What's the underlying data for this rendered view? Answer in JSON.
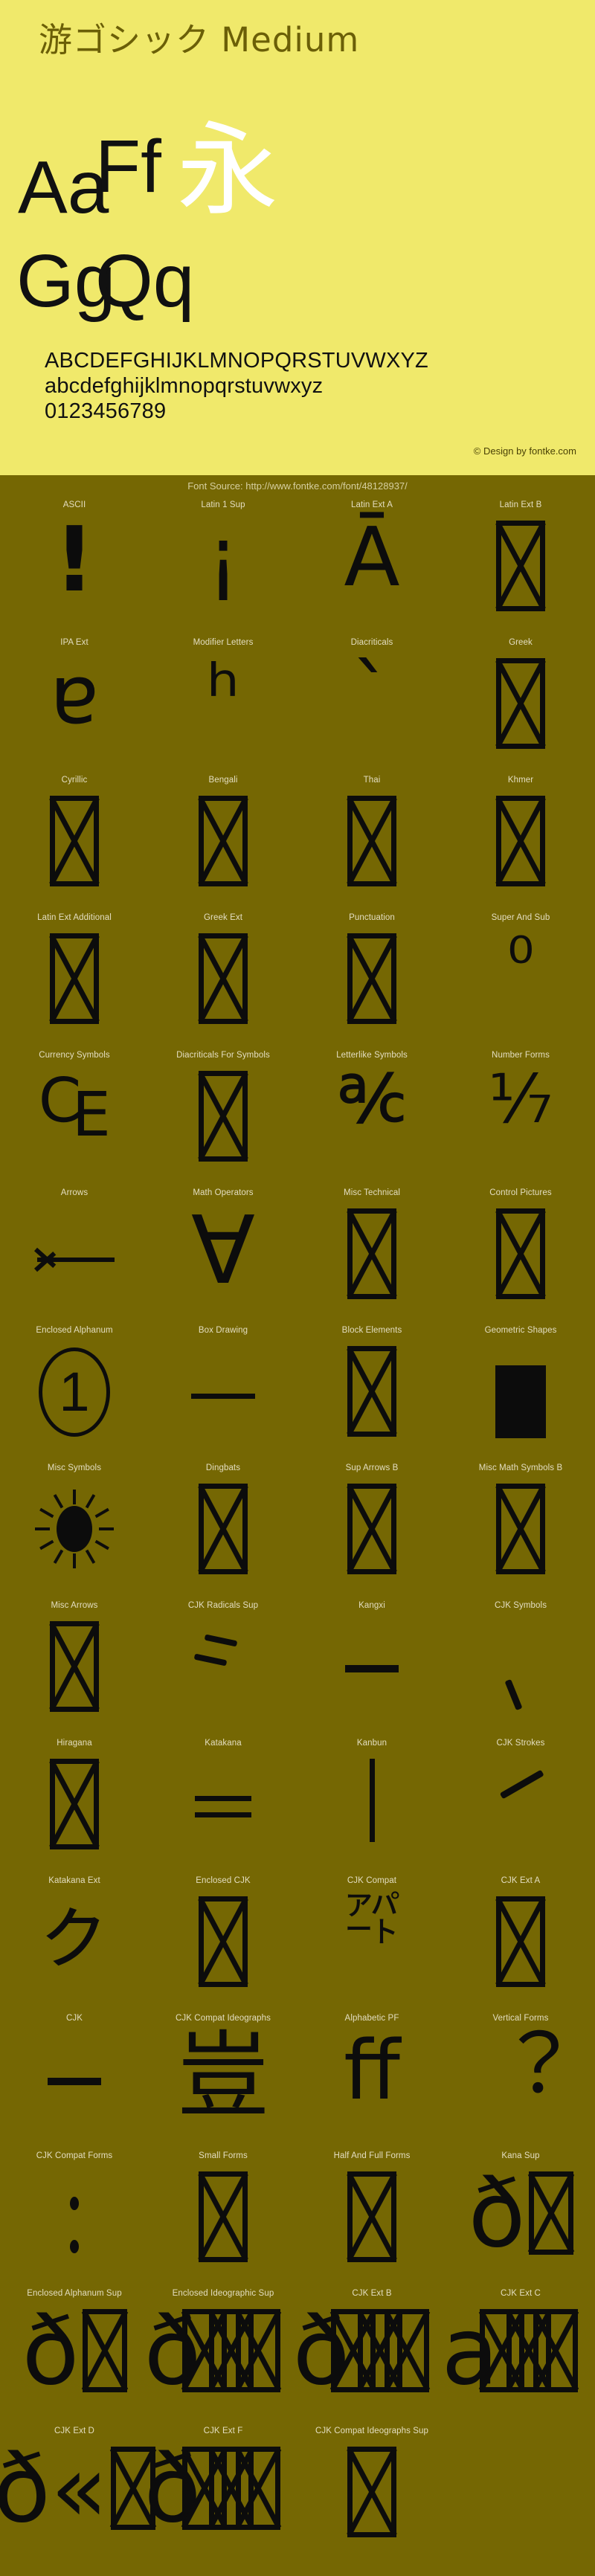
{
  "header": {
    "font_title": "游ゴシック Medium",
    "samples": [
      {
        "name": "sample-aa",
        "text": "Aa"
      },
      {
        "name": "sample-ff",
        "text": "Ff"
      },
      {
        "name": "sample-gg",
        "text": "Gg"
      },
      {
        "name": "sample-qq",
        "text": "Qq"
      },
      {
        "name": "sample-cjk",
        "text": "永"
      }
    ],
    "alphabet_upper": "ABCDEFGHIJKLMNOPQRSTUVWXYZ",
    "alphabet_lower": "abcdefghijklmnopqrstuvwxyz",
    "digits": "0123456789",
    "credit": "© Design by fontke.com"
  },
  "source_bar": {
    "text": "Font Source: http://www.fontke.com/font/48128937/"
  },
  "colors": {
    "header_bg": "#f0e96b",
    "body_bg": "#756703",
    "title_text": "#6b5f07",
    "glyph_black": "#0c0c0c",
    "glyph_white": "#ffffff",
    "label_text": "#e3ddc0",
    "source_text": "#d6cfa0"
  },
  "blocks": [
    {
      "label": "ASCII",
      "glyph": "!",
      "kind": "text-bang"
    },
    {
      "label": "Latin 1 Sup",
      "glyph": "¡",
      "kind": "text-plain"
    },
    {
      "label": "Latin Ext A",
      "glyph": "Ā",
      "kind": "text-plain"
    },
    {
      "label": "Latin Ext B",
      "glyph": "",
      "kind": "tofu"
    },
    {
      "label": "IPA Ext",
      "glyph": "ɐ",
      "kind": "text-plain"
    },
    {
      "label": "Modifier Letters",
      "glyph": "ʰ",
      "kind": "text-plain"
    },
    {
      "label": "Diacriticals",
      "glyph": "`",
      "kind": "text-plain"
    },
    {
      "label": "Greek",
      "glyph": "",
      "kind": "tofu"
    },
    {
      "label": "Cyrillic",
      "glyph": "",
      "kind": "tofu"
    },
    {
      "label": "Bengali",
      "glyph": "",
      "kind": "tofu"
    },
    {
      "label": "Thai",
      "glyph": "",
      "kind": "tofu"
    },
    {
      "label": "Khmer",
      "glyph": "",
      "kind": "tofu"
    },
    {
      "label": "Latin Ext Additional",
      "glyph": "",
      "kind": "tofu"
    },
    {
      "label": "Greek Ext",
      "glyph": "",
      "kind": "tofu"
    },
    {
      "label": "Punctuation",
      "glyph": "",
      "kind": "tofu"
    },
    {
      "label": "Super And Sub",
      "glyph": "⁰",
      "kind": "text-sup"
    },
    {
      "label": "Currency Symbols",
      "glyph": "₠",
      "kind": "text-plain"
    },
    {
      "label": "Diacriticals For Symbols",
      "glyph": "",
      "kind": "tofu"
    },
    {
      "label": "Letterlike Symbols",
      "glyph": "℀",
      "kind": "text-wide"
    },
    {
      "label": "Number Forms",
      "glyph": "⅐",
      "kind": "text-wide"
    },
    {
      "label": "Arrows",
      "glyph": "←",
      "kind": "arrow-left"
    },
    {
      "label": "Math Operators",
      "glyph": "∀",
      "kind": "text-big"
    },
    {
      "label": "Misc Technical",
      "glyph": "",
      "kind": "tofu"
    },
    {
      "label": "Control Pictures",
      "glyph": "",
      "kind": "tofu"
    },
    {
      "label": "Enclosed Alphanum",
      "glyph": "①",
      "kind": "circled-one"
    },
    {
      "label": "Box Drawing",
      "glyph": "─",
      "kind": "hline"
    },
    {
      "label": "Block Elements",
      "glyph": "",
      "kind": "tofu"
    },
    {
      "label": "Geometric Shapes",
      "glyph": "■",
      "kind": "black-rect"
    },
    {
      "label": "Misc Symbols",
      "glyph": "☀",
      "kind": "sun"
    },
    {
      "label": "Dingbats",
      "glyph": "",
      "kind": "tofu"
    },
    {
      "label": "Sup Arrows B",
      "glyph": "",
      "kind": "tofu"
    },
    {
      "label": "Misc Math Symbols B",
      "glyph": "",
      "kind": "tofu"
    },
    {
      "label": "Misc Arrows",
      "glyph": "",
      "kind": "tofu"
    },
    {
      "label": "CJK Radicals Sup",
      "glyph": "⺀",
      "kind": "radical-strokes"
    },
    {
      "label": "Kangxi",
      "glyph": "⼀",
      "kind": "hline-thick"
    },
    {
      "label": "CJK Symbols",
      "glyph": "、",
      "kind": "stroke-comma"
    },
    {
      "label": "Hiragana",
      "glyph": "",
      "kind": "tofu"
    },
    {
      "label": "Katakana",
      "glyph": "゠",
      "kind": "eq2"
    },
    {
      "label": "Kanbun",
      "glyph": "丨",
      "kind": "vline"
    },
    {
      "label": "CJK Strokes",
      "glyph": "㇀",
      "kind": "stroke-diag"
    },
    {
      "label": "Katakana Ext",
      "glyph": "ㇰ",
      "kind": "text-plain"
    },
    {
      "label": "Enclosed CJK",
      "glyph": "",
      "kind": "tofu"
    },
    {
      "label": "CJK Compat",
      "glyph": "㌀",
      "kind": "text-compat"
    },
    {
      "label": "CJK Ext A",
      "glyph": "",
      "kind": "tofu"
    },
    {
      "label": "CJK",
      "glyph": "一",
      "kind": "hline-thick"
    },
    {
      "label": "CJK Compat Ideographs",
      "glyph": "豈",
      "kind": "text-big"
    },
    {
      "label": "Alphabetic PF",
      "glyph": "ﬀ",
      "kind": "text-plain"
    },
    {
      "label": "Vertical Forms",
      "glyph": "︖",
      "kind": "text-plain"
    },
    {
      "label": "CJK Compat Forms",
      "glyph": "︰",
      "kind": "dots2"
    },
    {
      "label": "Small Forms",
      "glyph": "",
      "kind": "tofu"
    },
    {
      "label": "Half And Full Forms",
      "glyph": "",
      "kind": "tofu"
    },
    {
      "label": "Kana Sup",
      "glyph": "ð",
      "kind": "overflow-pair"
    },
    {
      "label": "Enclosed Alphanum Sup",
      "glyph": "ð",
      "kind": "overflow-pair"
    },
    {
      "label": "Enclosed Ideographic Sup",
      "glyph": "ð",
      "kind": "overflow-jam"
    },
    {
      "label": "CJK Ext B",
      "glyph": "ð",
      "kind": "overflow-jam"
    },
    {
      "label": "CJK Ext C",
      "glyph": "a",
      "kind": "overflow-jam"
    },
    {
      "label": "CJK Ext D",
      "glyph": "ð«",
      "kind": "overflow-pair"
    },
    {
      "label": "CJK Ext F",
      "glyph": "ð",
      "kind": "overflow-jam"
    },
    {
      "label": "CJK Compat Ideographs Sup",
      "glyph": "",
      "kind": "tofu"
    }
  ]
}
